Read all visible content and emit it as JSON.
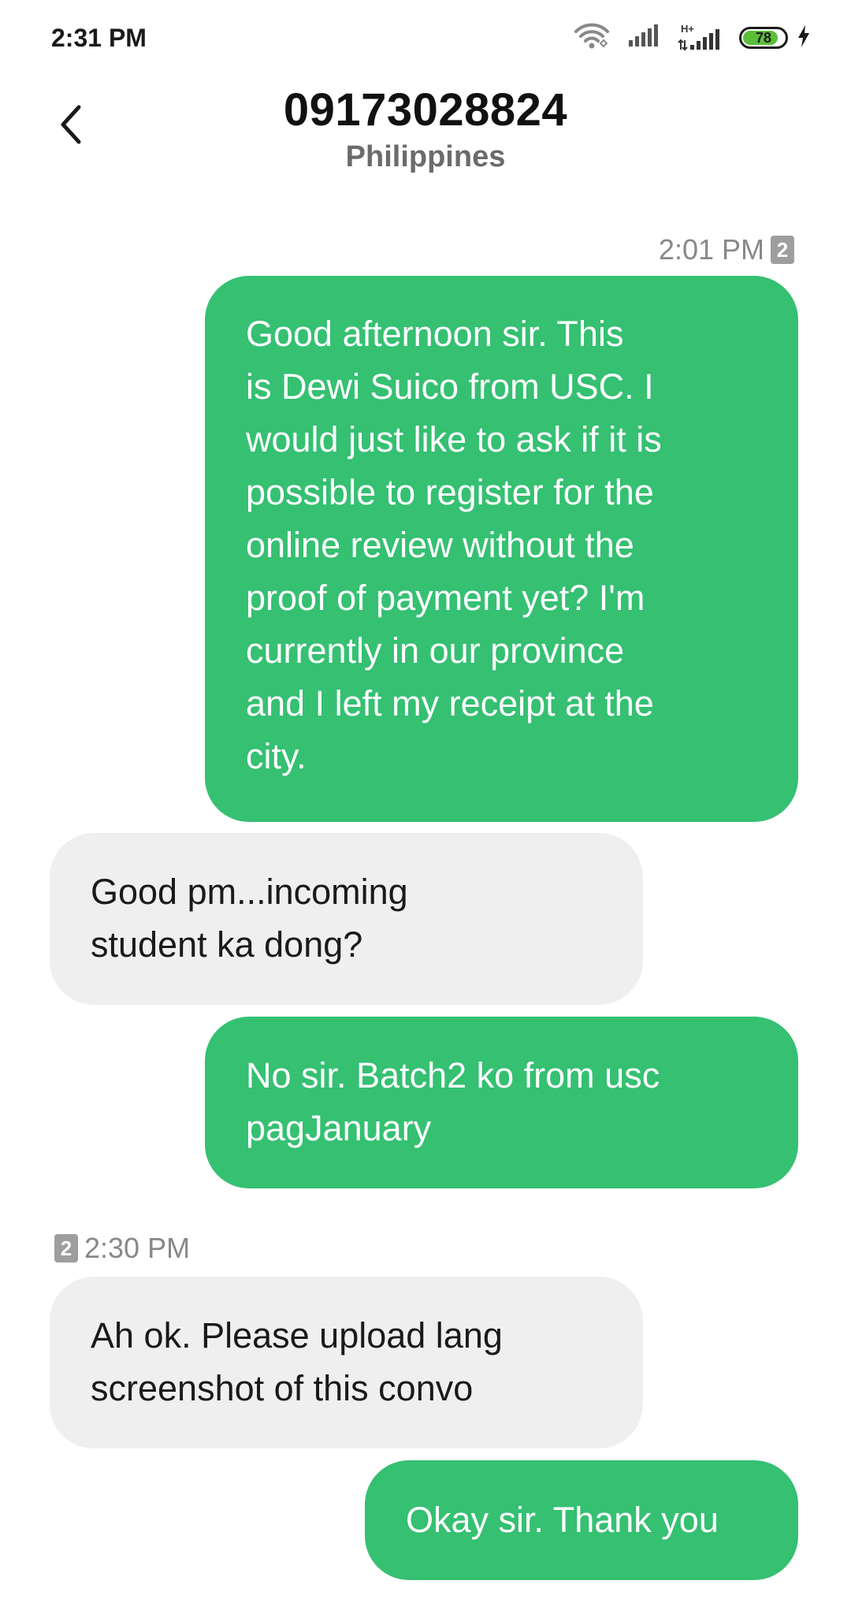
{
  "status_bar": {
    "time": "2:31 PM",
    "battery_level": "78",
    "network_type": "H+",
    "icons": [
      "wifi-icon",
      "signal-icon",
      "signal-h-plus-icon",
      "battery-icon",
      "charging-bolt-icon"
    ]
  },
  "header": {
    "title": "09173028824",
    "subtitle": "Philippines",
    "back_icon": "chevron-left-icon"
  },
  "colors": {
    "outgoing_bubble": "#35c072",
    "incoming_bubble": "#efefef",
    "timestamp": "#888888",
    "battery_fill": "#5bbf3a"
  },
  "conversation": {
    "timestamp_1": {
      "time": "2:01 PM",
      "sim": "2"
    },
    "timestamp_2": {
      "time": "2:30 PM",
      "sim": "2"
    },
    "messages": [
      {
        "direction": "outgoing",
        "text": "Good afternoon sir. This\nis Dewi Suico from USC. I\nwould just like to ask if it is\npossible to register for the\nonline review without the\nproof of payment yet? I'm\ncurrently in our province\nand I left my receipt at the\ncity."
      },
      {
        "direction": "incoming",
        "text": "Good pm...incoming\nstudent ka dong?"
      },
      {
        "direction": "outgoing",
        "text": "No sir. Batch2 ko from usc\npagJanuary"
      },
      {
        "direction": "incoming",
        "text": "Ah ok. Please upload lang\nscreenshot of this convo"
      },
      {
        "direction": "outgoing",
        "text": "Okay sir. Thank you"
      }
    ]
  }
}
